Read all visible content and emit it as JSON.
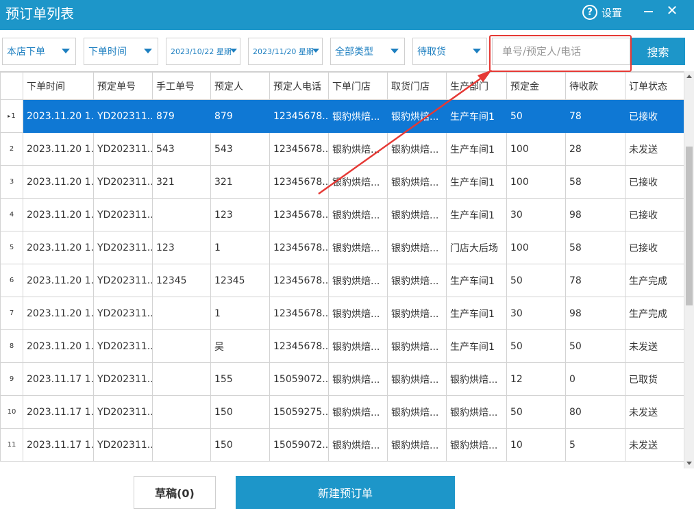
{
  "window": {
    "title": "预订单列表",
    "settings_label": "设置",
    "help_glyph": "?",
    "close_glyph": "✕"
  },
  "filters": {
    "store_scope": "本店下单",
    "time_field": "下单时间",
    "start_date": "2023/10/22 星期",
    "end_date": "2023/11/20 星期",
    "type": "全部类型",
    "status": "待取货",
    "search_placeholder": "单号/预定人/电话",
    "search_button": "搜索"
  },
  "table": {
    "columns": [
      "下单时间",
      "预定单号",
      "手工单号",
      "预定人",
      "预定人电话",
      "下单门店",
      "取货门店",
      "生产部门",
      "预定金",
      "待收款",
      "订单状态"
    ],
    "rows": [
      {
        "num": "1",
        "cells": [
          "2023.11.20 1...",
          "YD202311...",
          "879",
          "879",
          "12345678...",
          "银豹烘焙...",
          "银豹烘焙...",
          "生产车间1",
          "50",
          "78",
          "已接收"
        ]
      },
      {
        "num": "2",
        "cells": [
          "2023.11.20 1...",
          "YD202311...",
          "543",
          "543",
          "12345678...",
          "银豹烘焙...",
          "银豹烘焙...",
          "生产车间1",
          "100",
          "28",
          "未发送"
        ]
      },
      {
        "num": "3",
        "cells": [
          "2023.11.20 1...",
          "YD202311...",
          "321",
          "321",
          "12345678...",
          "银豹烘焙...",
          "银豹烘焙...",
          "生产车间1",
          "100",
          "58",
          "已接收"
        ]
      },
      {
        "num": "4",
        "cells": [
          "2023.11.20 1...",
          "YD202311...",
          "",
          "123",
          "12345678...",
          "银豹烘焙...",
          "银豹烘焙...",
          "生产车间1",
          "30",
          "98",
          "已接收"
        ]
      },
      {
        "num": "5",
        "cells": [
          "2023.11.20 1...",
          "YD202311...",
          "123",
          "1",
          "12345678...",
          "银豹烘焙...",
          "银豹烘焙...",
          "门店大后场",
          "100",
          "58",
          "已接收"
        ]
      },
      {
        "num": "6",
        "cells": [
          "2023.11.20 1...",
          "YD202311...",
          "12345",
          "12345",
          "12345678...",
          "银豹烘焙...",
          "银豹烘焙...",
          "生产车间1",
          "50",
          "78",
          "生产完成"
        ]
      },
      {
        "num": "7",
        "cells": [
          "2023.11.20 1...",
          "YD202311...",
          "",
          "1",
          "12345678...",
          "银豹烘焙...",
          "银豹烘焙...",
          "生产车间1",
          "30",
          "98",
          "生产完成"
        ]
      },
      {
        "num": "8",
        "cells": [
          "2023.11.20 1...",
          "YD202311...",
          "",
          "吴",
          "12345678...",
          "银豹烘焙...",
          "银豹烘焙...",
          "生产车间1",
          "50",
          "50",
          "未发送"
        ]
      },
      {
        "num": "9",
        "cells": [
          "2023.11.17 1...",
          "YD202311...",
          "",
          "155",
          "15059072...",
          "银豹烘焙...",
          "银豹烘焙...",
          "银豹烘焙...",
          "12",
          "0",
          "已取货"
        ]
      },
      {
        "num": "10",
        "cells": [
          "2023.11.17 1...",
          "YD202311...",
          "",
          "150",
          "15059275...",
          "银豹烘焙...",
          "银豹烘焙...",
          "银豹烘焙...",
          "50",
          "80",
          "未发送"
        ]
      },
      {
        "num": "11",
        "cells": [
          "2023.11.17 1...",
          "YD202311...",
          "",
          "150",
          "15059072...",
          "银豹烘焙...",
          "银豹烘焙...",
          "银豹烘焙...",
          "10",
          "5",
          "未发送"
        ]
      }
    ],
    "selected_row": "1",
    "selected_marker": "▸"
  },
  "footer": {
    "draft_button": "草稿(0)",
    "new_button": "新建预订单"
  },
  "colors": {
    "title_bar": "#1d96c9",
    "accent_text": "#1d7fc0",
    "selected_row": "#0f78d4",
    "annotation": "#e53935"
  }
}
